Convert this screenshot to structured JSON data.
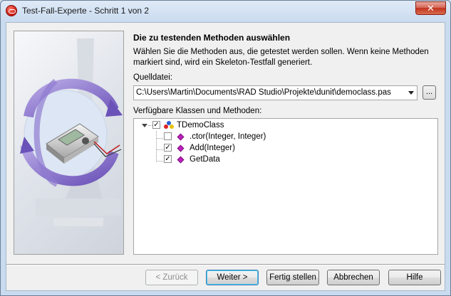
{
  "window": {
    "title": "Test-Fall-Experte - Schritt 1 von 2",
    "close_label": "✕"
  },
  "page": {
    "heading": "Die zu testenden Methoden auswählen",
    "description": "Wählen Sie die Methoden aus, die getestet werden sollen. Wenn keine Methoden markiert sind, wird ein Skeleton-Testfall generiert."
  },
  "source": {
    "label": "Quelldatei:",
    "value": "C:\\Users\\Martin\\Documents\\RAD Studio\\Projekte\\dunit\\democlass.pas",
    "browse_label": "..."
  },
  "tree": {
    "label": "Verfügbare Klassen und Methoden:",
    "root": {
      "label": "TDemoClass",
      "checked": true,
      "expanded": true
    },
    "methods": [
      {
        "label": ".ctor(Integer, Integer)",
        "checked": false
      },
      {
        "label": "Add(Integer)",
        "checked": true
      },
      {
        "label": "GetData",
        "checked": true
      }
    ]
  },
  "buttons": {
    "back": "< Zurück",
    "next": "Weiter >",
    "finish": "Fertig stellen",
    "cancel": "Abbrechen",
    "help": "Hilfe"
  },
  "colors": {
    "method_icon": "#c020c0",
    "accent": "#3c7fb1"
  }
}
